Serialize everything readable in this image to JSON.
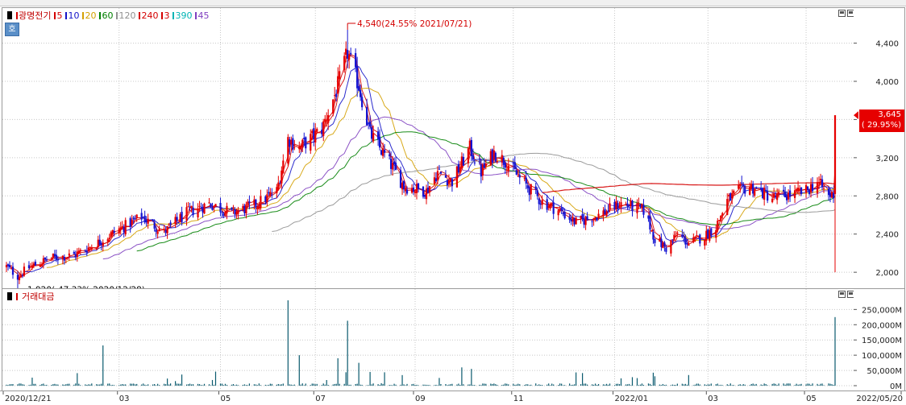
{
  "price_panel": {
    "legend": {
      "title": "광명전기",
      "items": [
        {
          "label": "5",
          "color": "#d40000"
        },
        {
          "label": "10",
          "color": "#1414c8"
        },
        {
          "label": "20",
          "color": "#d4a000"
        },
        {
          "label": "60",
          "color": "#008000"
        },
        {
          "label": "120",
          "color": "#909090"
        },
        {
          "label": "240",
          "color": "#d40000"
        },
        {
          "label": "3",
          "color": "#d40000"
        },
        {
          "label": "390",
          "color": "#00b4b4"
        },
        {
          "label": "45",
          "color": "#8040c0"
        }
      ]
    },
    "badge": "호",
    "high_annotation": "4,540(24.55% 2021/07/21)",
    "low_annotation": "1,920(-47.33% 2020/12/28)",
    "last_price": "3,645",
    "last_change": "( 29.95%)"
  },
  "volume_panel": {
    "legend": {
      "title": "거래대금",
      "color": "#d40000"
    }
  },
  "x_axis_labels": [
    "2020/12/21",
    "03",
    "05",
    "07",
    "09",
    "11",
    "2022/01",
    "03",
    "05",
    "2022/05/20"
  ],
  "colors": {
    "up": "#e60000",
    "down": "#1414d2",
    "grid": "#c8c8c8",
    "ma5": "#d40000",
    "ma10": "#1414c8",
    "ma20": "#d4a000",
    "ma60": "#008000",
    "ma120": "#909090",
    "ma240": "#d40000",
    "ma390": "#00b4b4",
    "ma45": "#8040c0"
  },
  "chart_data": [
    {
      "type": "candlestick",
      "title": "광명전기",
      "x": [
        "2020/12/21",
        "2021/03",
        "2021/05",
        "2021/07",
        "2021/09",
        "2021/11",
        "2022/01",
        "2022/03",
        "2022/05",
        "2022/05/20"
      ],
      "ylim": [
        1900,
        4700
      ],
      "y_ticks": [
        "2,000",
        "2,400",
        "2,800",
        "3,200",
        "3,600",
        "4,000",
        "4,400"
      ],
      "y_tick_values": [
        2000,
        2400,
        2800,
        3200,
        3600,
        4000,
        4400
      ],
      "price_path": [
        [
          "2020/12/21",
          2060
        ],
        [
          "2020/12/28",
          1960
        ],
        [
          "2021/01/04",
          2050
        ],
        [
          "2021/01/18",
          2150
        ],
        [
          "2021/02/01",
          2180
        ],
        [
          "2021/02/15",
          2300
        ],
        [
          "2021/03/01",
          2450
        ],
        [
          "2021/03/15",
          2580
        ],
        [
          "2021/03/29",
          2420
        ],
        [
          "2021/04/12",
          2620
        ],
        [
          "2021/04/26",
          2720
        ],
        [
          "2021/05/10",
          2620
        ],
        [
          "2021/05/24",
          2700
        ],
        [
          "2021/06/07",
          2850
        ],
        [
          "2021/06/14",
          3400
        ],
        [
          "2021/06/21",
          3300
        ],
        [
          "2021/07/05",
          3500
        ],
        [
          "2021/07/14",
          3900
        ],
        [
          "2021/07/21",
          4300
        ],
        [
          "2021/07/28",
          3950
        ],
        [
          "2021/08/04",
          3450
        ],
        [
          "2021/08/18",
          3100
        ],
        [
          "2021/08/25",
          2900
        ],
        [
          "2021/09/08",
          2850
        ],
        [
          "2021/09/15",
          3050
        ],
        [
          "2021/09/24",
          2950
        ],
        [
          "2021/10/05",
          3300
        ],
        [
          "2021/10/12",
          3050
        ],
        [
          "2021/10/20",
          3250
        ],
        [
          "2021/10/28",
          3150
        ],
        [
          "2021/11/04",
          3000
        ],
        [
          "2021/11/18",
          2750
        ],
        [
          "2021/11/29",
          2650
        ],
        [
          "2021/12/10",
          2520
        ],
        [
          "2021/12/24",
          2600
        ],
        [
          "2022/01/07",
          2720
        ],
        [
          "2022/01/21",
          2650
        ],
        [
          "2022/01/28",
          2350
        ],
        [
          "2022/02/04",
          2250
        ],
        [
          "2022/02/11",
          2400
        ],
        [
          "2022/02/18",
          2300
        ],
        [
          "2022/02/28",
          2380
        ],
        [
          "2022/03/07",
          2480
        ],
        [
          "2022/03/14",
          2750
        ],
        [
          "2022/03/21",
          2850
        ],
        [
          "2022/03/28",
          2900
        ],
        [
          "2022/04/11",
          2780
        ],
        [
          "2022/04/25",
          2820
        ],
        [
          "2022/05/02",
          2850
        ],
        [
          "2022/05/09",
          2950
        ],
        [
          "2022/05/16",
          2800
        ],
        [
          "2022/05/19",
          2820
        ],
        [
          "2022/05/20",
          3645
        ]
      ],
      "high": {
        "value": 4540,
        "change": "24.55%",
        "date": "2021/07/21"
      },
      "low": {
        "value": 1920,
        "change": "-47.33%",
        "date": "2020/12/28"
      },
      "last": {
        "value": 3645,
        "change": "29.95%"
      },
      "moving_averages": [
        "5",
        "10",
        "20",
        "60",
        "120",
        "240",
        "3",
        "390",
        "45"
      ]
    },
    {
      "type": "bar",
      "title": "거래대금",
      "ylim": [
        0,
        280000
      ],
      "y_ticks": [
        "0M",
        "50,000M",
        "100,000M",
        "150,000M",
        "200,000M",
        "250,000M"
      ],
      "y_tick_values": [
        0,
        50000,
        100000,
        150000,
        200000,
        250000
      ],
      "unit": "M",
      "spikes": [
        [
          "2021/02/19",
          132000
        ],
        [
          "2021/04/05",
          15000
        ],
        [
          "2021/06/14",
          290000
        ],
        [
          "2021/06/21",
          100000
        ],
        [
          "2021/07/15",
          90000
        ],
        [
          "2021/07/21",
          213000
        ],
        [
          "2021/07/28",
          75000
        ],
        [
          "2021/08/04",
          45000
        ],
        [
          "2021/09/30",
          60000
        ],
        [
          "2021/10/06",
          55000
        ],
        [
          "2022/05/20",
          225000
        ]
      ],
      "baseline": 5000
    }
  ]
}
